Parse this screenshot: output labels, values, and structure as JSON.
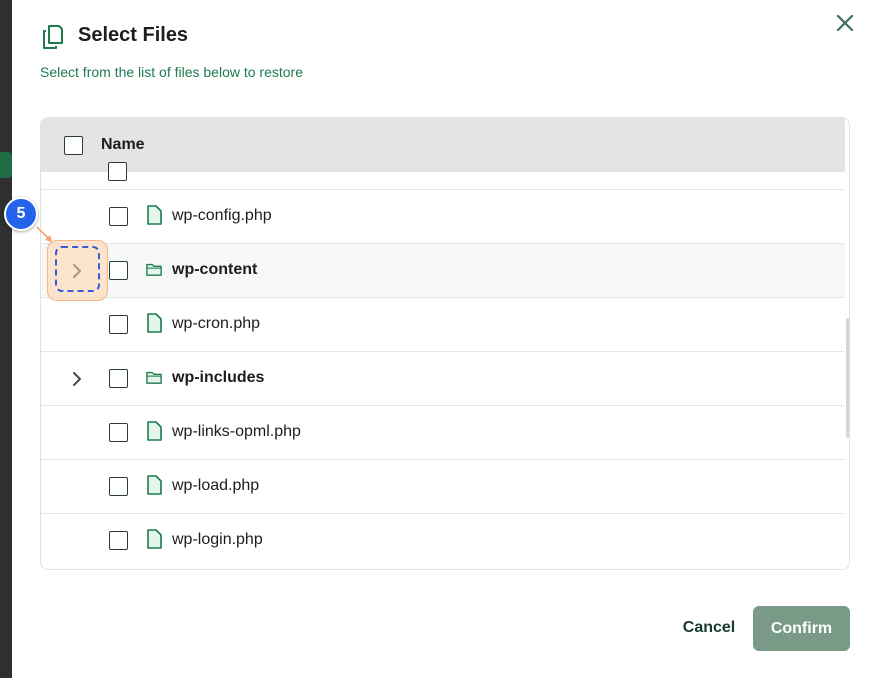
{
  "dialog": {
    "title": "Select Files",
    "subtitle": "Select from the list of files below to restore",
    "close_icon": "close-icon",
    "header_icon": "files-copy-icon"
  },
  "table": {
    "column_name": "Name",
    "rows": [
      {
        "name": "wp-config.php",
        "type": "file",
        "expandable": false
      },
      {
        "name": "wp-content",
        "type": "folder",
        "expandable": true
      },
      {
        "name": "wp-cron.php",
        "type": "file",
        "expandable": false
      },
      {
        "name": "wp-includes",
        "type": "folder",
        "expandable": true
      },
      {
        "name": "wp-links-opml.php",
        "type": "file",
        "expandable": false
      },
      {
        "name": "wp-load.php",
        "type": "file",
        "expandable": false
      },
      {
        "name": "wp-login.php",
        "type": "file",
        "expandable": false
      }
    ]
  },
  "annotation": {
    "step_number": "5"
  },
  "footer": {
    "cancel_label": "Cancel",
    "confirm_label": "Confirm"
  },
  "colors": {
    "accent_green": "#1f7a4d",
    "confirm_bg": "#7a9a88",
    "header_bg": "#e4e4e7",
    "step_badge": "#2563eb",
    "highlight": "#f5b585"
  }
}
